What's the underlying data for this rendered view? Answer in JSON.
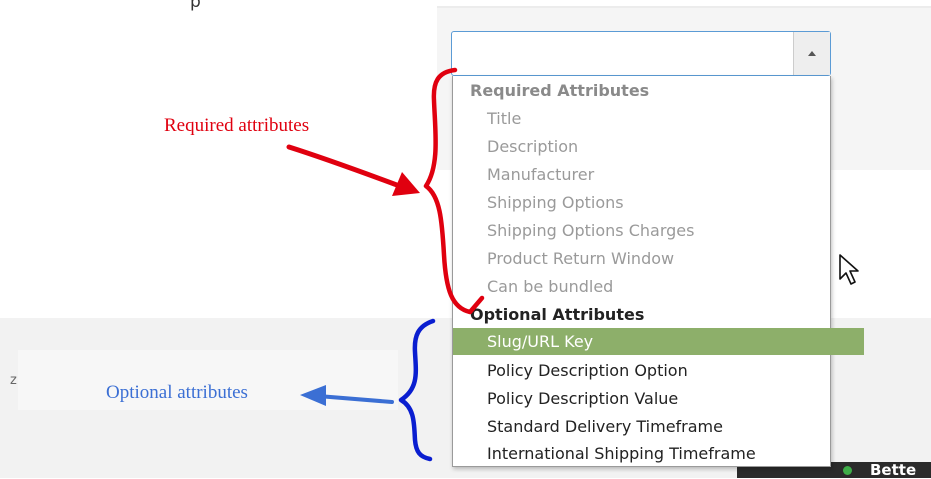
{
  "page": {
    "cut_top_text": "p",
    "side_text": "z",
    "taskbar_label": "Bette"
  },
  "select": {
    "value": "",
    "arrow_icon": "triangle-up-icon"
  },
  "dropdown": {
    "groups": [
      {
        "label": "Required Attributes",
        "disabled": true,
        "options": [
          {
            "label": "Title"
          },
          {
            "label": "Description"
          },
          {
            "label": "Manufacturer"
          },
          {
            "label": "Shipping Options"
          },
          {
            "label": "Shipping Options Charges"
          },
          {
            "label": "Product Return Window"
          },
          {
            "label": "Can be bundled"
          }
        ]
      },
      {
        "label": "Optional Attributes",
        "disabled": false,
        "options": [
          {
            "label": "Slug/URL Key",
            "selected": true
          },
          {
            "label": "Policy Description Option"
          },
          {
            "label": "Policy Description Value"
          },
          {
            "label": "Standard Delivery Timeframe"
          },
          {
            "label": "International Shipping Timeframe"
          }
        ]
      }
    ]
  },
  "annotations": {
    "required_label": "Required attributes",
    "optional_label": "Optional attributes",
    "colors": {
      "required": "#e0000f",
      "optional": "#3b6fd4",
      "brace_optional": "#0a1ed0"
    }
  },
  "colors": {
    "selected_option_bg": "#8daf6a",
    "select_border": "#5b9bd5",
    "status_dot": "#3fae49"
  }
}
